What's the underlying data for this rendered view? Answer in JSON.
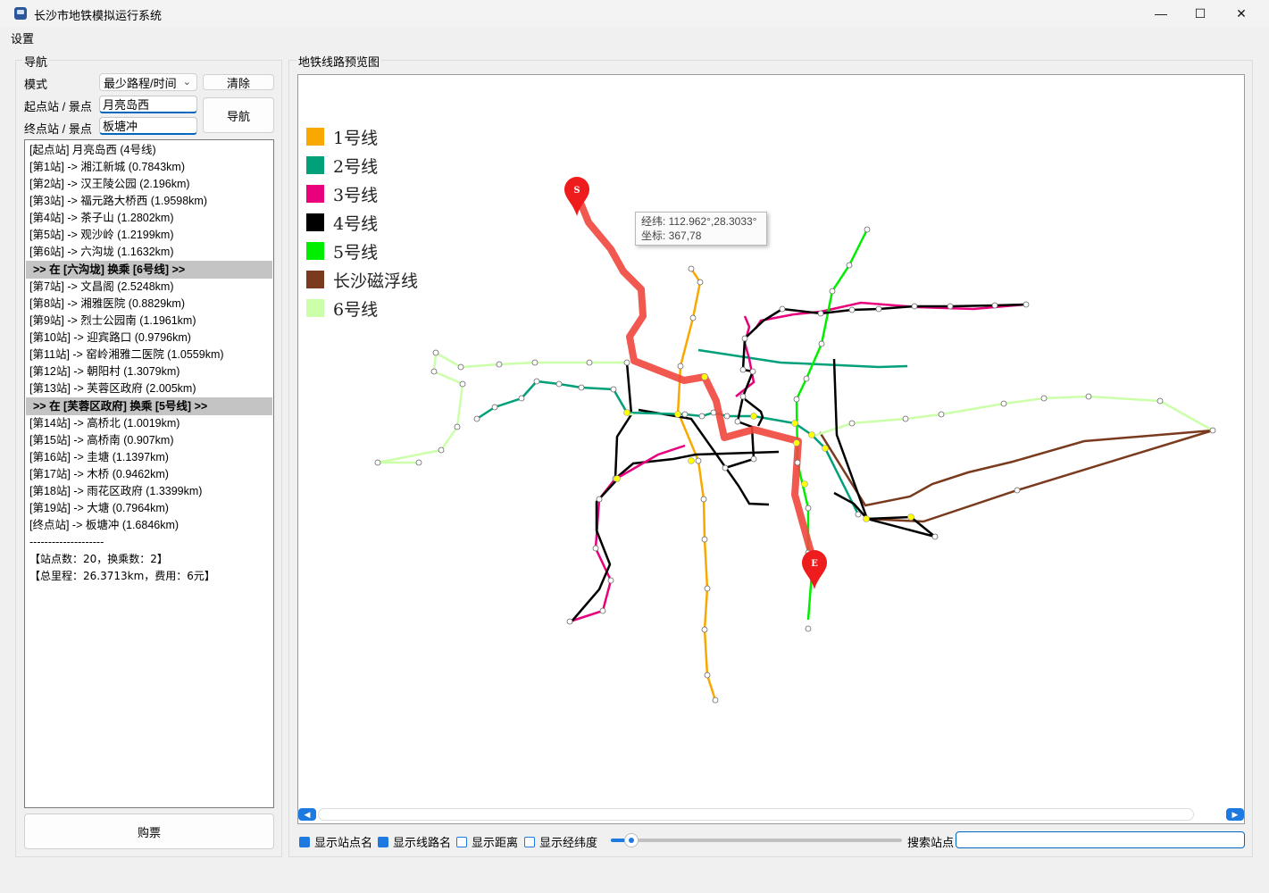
{
  "window": {
    "title": "长沙市地铁模拟运行系统",
    "minimize": "—",
    "maximize": "☐",
    "close": "✕"
  },
  "menu": {
    "settings": "设置"
  },
  "nav": {
    "group_title": "导航",
    "mode_label": "模式",
    "mode_value": "最少路程/时间",
    "clear_button": "清除",
    "start_label": "起点站 / 景点",
    "start_value": "月亮岛西",
    "end_label": "终点站 / 景点",
    "end_value": "板塘冲",
    "nav_button": "导航",
    "buy_button": "购票"
  },
  "results": [
    {
      "text": "[起点站] 月亮岛西 (4号线)",
      "kind": "step"
    },
    {
      "text": "[第1站] -> 湘江新城  (0.7843km)",
      "kind": "step"
    },
    {
      "text": "[第2站] -> 汉王陵公园  (2.196km)",
      "kind": "step"
    },
    {
      "text": "[第3站] -> 福元路大桥西  (1.9598km)",
      "kind": "step"
    },
    {
      "text": "[第4站] -> 茶子山  (1.2802km)",
      "kind": "step"
    },
    {
      "text": "[第5站] -> 观沙岭  (1.2199km)",
      "kind": "step"
    },
    {
      "text": "[第6站] -> 六沟垅  (1.1632km)",
      "kind": "step"
    },
    {
      "text": ">> 在 [六沟垅] 换乘 [6号线] >>",
      "kind": "transfer"
    },
    {
      "text": "[第7站] -> 文昌阁  (2.5248km)",
      "kind": "step"
    },
    {
      "text": "[第8站] -> 湘雅医院  (0.8829km)",
      "kind": "step"
    },
    {
      "text": "[第9站] -> 烈士公园南  (1.1961km)",
      "kind": "step"
    },
    {
      "text": "[第10站] -> 迎宾路口  (0.9796km)",
      "kind": "step"
    },
    {
      "text": "[第11站] -> 窑岭湘雅二医院  (1.0559km)",
      "kind": "step"
    },
    {
      "text": "[第12站] -> 朝阳村  (1.3079km)",
      "kind": "step"
    },
    {
      "text": "[第13站] -> 芙蓉区政府  (2.005km)",
      "kind": "step"
    },
    {
      "text": ">> 在 [芙蓉区政府] 换乘 [5号线] >>",
      "kind": "transfer"
    },
    {
      "text": "[第14站] -> 高桥北  (1.0019km)",
      "kind": "step"
    },
    {
      "text": "[第15站] -> 高桥南  (0.907km)",
      "kind": "step"
    },
    {
      "text": "[第16站] -> 圭塘  (1.1397km)",
      "kind": "step"
    },
    {
      "text": "[第17站] -> 木桥  (0.9462km)",
      "kind": "step"
    },
    {
      "text": "[第18站] -> 雨花区政府  (1.3399km)",
      "kind": "step"
    },
    {
      "text": "[第19站] -> 大塘  (0.7964km)",
      "kind": "step"
    },
    {
      "text": "[终点站] -> 板塘冲  (1.6846km)",
      "kind": "step"
    },
    {
      "text": "--------------------",
      "kind": "step"
    },
    {
      "text": "【站点数：20，换乘数：2】",
      "kind": "summary"
    },
    {
      "text": "【总里程：26.3713km，费用：6元】",
      "kind": "summary"
    }
  ],
  "map": {
    "group_title": "地铁线路预览图",
    "legend": [
      {
        "label": "1号线",
        "color": "#f9a800"
      },
      {
        "label": "2号线",
        "color": "#00a07a"
      },
      {
        "label": "3号线",
        "color": "#e8007d"
      },
      {
        "label": "4号线",
        "color": "#000000"
      },
      {
        "label": "5号线",
        "color": "#00ee00"
      },
      {
        "label": "长沙磁浮线",
        "color": "#7a3a1e"
      },
      {
        "label": "6号线",
        "color": "#ccffaa"
      }
    ],
    "route_color": "#f0463c",
    "start_marker": "S",
    "end_marker": "E",
    "tooltip_line1": "经纬: 112.962°,28.3033°",
    "tooltip_line2": "坐标: 367,78"
  },
  "options": {
    "show_station_names": {
      "label": "显示站点名",
      "checked": true
    },
    "show_line_names": {
      "label": "显示线路名",
      "checked": true
    },
    "show_distance": {
      "label": "显示距离",
      "checked": false
    },
    "show_latlng": {
      "label": "显示经纬度",
      "checked": false
    },
    "zoom_level": 0.07,
    "search_label": "搜索站点",
    "search_value": ""
  },
  "icons": {
    "app": "metro-app-icon",
    "scroll_left": "scroll-left-icon",
    "scroll_right": "scroll-right-icon",
    "combo_arrow": "chevron-down-icon"
  }
}
